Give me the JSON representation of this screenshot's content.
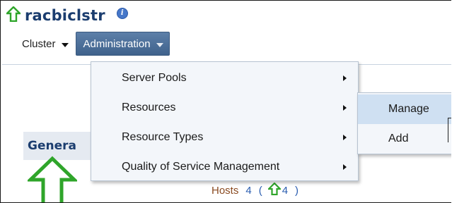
{
  "header": {
    "title": "racbiclstr",
    "status_icon": "up-arrow-icon",
    "info_icon": "info-icon"
  },
  "menubar": {
    "items": [
      {
        "label": "Cluster"
      },
      {
        "label": "Administration"
      }
    ]
  },
  "dropdown": {
    "items": [
      {
        "label": "Server Pools"
      },
      {
        "label": "Resources"
      },
      {
        "label": "Resource Types"
      },
      {
        "label": "Quality of Service Management"
      }
    ]
  },
  "submenu": {
    "items": [
      {
        "label": "Manage"
      },
      {
        "label": "Add"
      }
    ]
  },
  "general": {
    "title": "Genera",
    "hosts_label": "Hosts",
    "hosts_count": "4",
    "open_paren": "(",
    "hosts_up_count": "4",
    "close_paren": ")"
  },
  "colors": {
    "status_up": "#2fa52a",
    "title_blue": "#1b3d6f",
    "menu_active": "#4a6d97",
    "link_blue": "#2a5db0"
  }
}
